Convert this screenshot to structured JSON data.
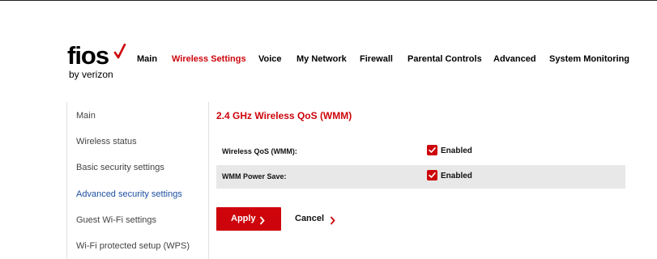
{
  "brand": {
    "name": "fios",
    "byline": "by verizon",
    "accent_color": "#cd040b",
    "icon": "checkmark-icon"
  },
  "nav": {
    "items": [
      "Main",
      "Wireless Settings",
      "Voice",
      "My Network",
      "Firewall",
      "Parental Controls",
      "Advanced",
      "System Monitoring"
    ],
    "active": "Wireless Settings"
  },
  "sidebar": {
    "items": [
      "Main",
      "Wireless status",
      "Basic security settings",
      "Advanced security settings",
      "Guest Wi-Fi settings",
      "Wi-Fi protected setup (WPS)"
    ],
    "active": "Advanced security settings"
  },
  "content": {
    "title": "2.4 GHz Wireless QoS (WMM)",
    "rows": [
      {
        "label": "Wireless QoS (WMM):",
        "checked": true,
        "value_label": "Enabled"
      },
      {
        "label": "WMM Power Save:",
        "checked": true,
        "value_label": "Enabled"
      }
    ]
  },
  "actions": {
    "apply_label": "Apply",
    "cancel_label": "Cancel",
    "chevron_icon": "chevron-right-icon"
  }
}
